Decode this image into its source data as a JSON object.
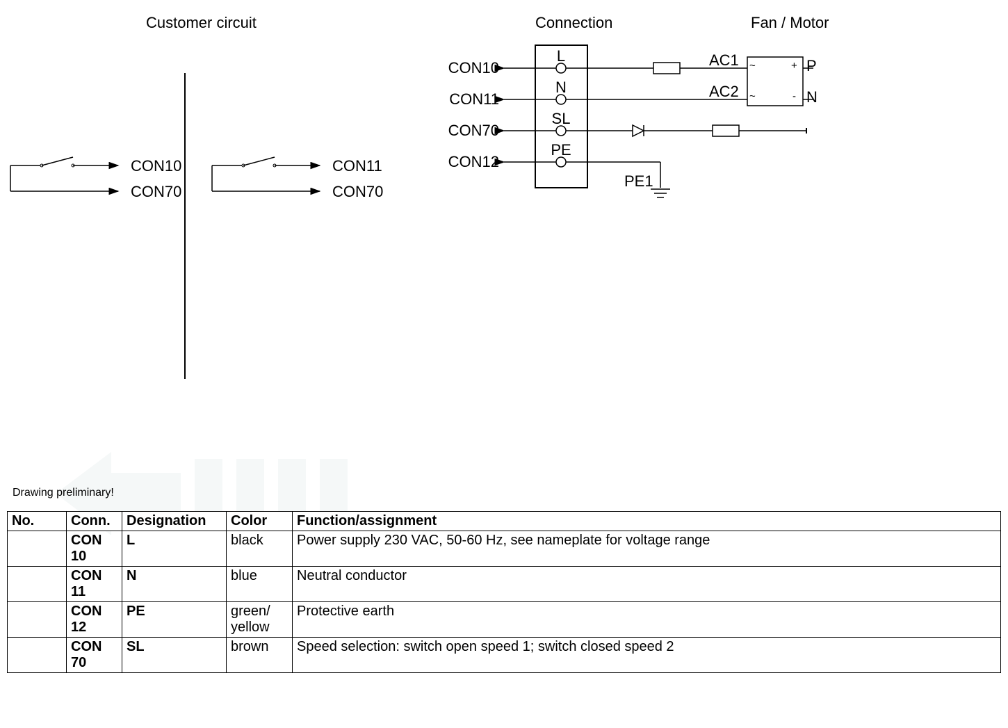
{
  "headers": {
    "customer": "Customer circuit",
    "connection": "Connection",
    "fanmotor": "Fan / Motor"
  },
  "customer_circuit": {
    "left": {
      "out1": "CON10",
      "out2": "CON70"
    },
    "right": {
      "out1": "CON11",
      "out2": "CON70"
    }
  },
  "connection_block": {
    "rows": [
      {
        "con": "CON10",
        "pin": "L"
      },
      {
        "con": "CON11",
        "pin": "N"
      },
      {
        "con": "CON70",
        "pin": "SL"
      },
      {
        "con": "CON12",
        "pin": "PE"
      }
    ],
    "signals": {
      "ac1": "AC1",
      "ac2": "AC2",
      "pe1": "PE1"
    },
    "rectifier": {
      "p": "P",
      "n": "N",
      "tl": "~",
      "tr": "+",
      "bl": "~",
      "br": "-"
    }
  },
  "note": "Drawing preliminary!",
  "table": {
    "headers": {
      "no": "No.",
      "conn": "Conn.",
      "desig": "Designation",
      "color": "Color",
      "func": "Function/assignment"
    },
    "rows": [
      {
        "no": "",
        "conn": "CON 10",
        "desig": "L",
        "color": "black",
        "func": "Power supply 230 VAC, 50-60 Hz, see nameplate for voltage range"
      },
      {
        "no": "",
        "conn": "CON 11",
        "desig": "N",
        "color": "blue",
        "func": "Neutral conductor"
      },
      {
        "no": "",
        "conn": "CON 12",
        "desig": "PE",
        "color": "green/\nyellow",
        "func": "Protective earth"
      },
      {
        "no": "",
        "conn": "CON 70",
        "desig": "SL",
        "color": "brown",
        "func": "Speed selection: switch open speed 1; switch closed speed 2"
      }
    ]
  },
  "chart_data": {
    "type": "table",
    "title": "Connection assignment table",
    "columns": [
      "No.",
      "Conn.",
      "Designation",
      "Color",
      "Function/assignment"
    ],
    "rows": [
      [
        "",
        "CON 10",
        "L",
        "black",
        "Power supply 230 VAC, 50-60 Hz, see nameplate for voltage range"
      ],
      [
        "",
        "CON 11",
        "N",
        "blue",
        "Neutral conductor"
      ],
      [
        "",
        "CON 12",
        "PE",
        "green/yellow",
        "Protective earth"
      ],
      [
        "",
        "CON 70",
        "SL",
        "brown",
        "Speed selection: switch open speed 1; switch closed speed 2"
      ]
    ]
  }
}
